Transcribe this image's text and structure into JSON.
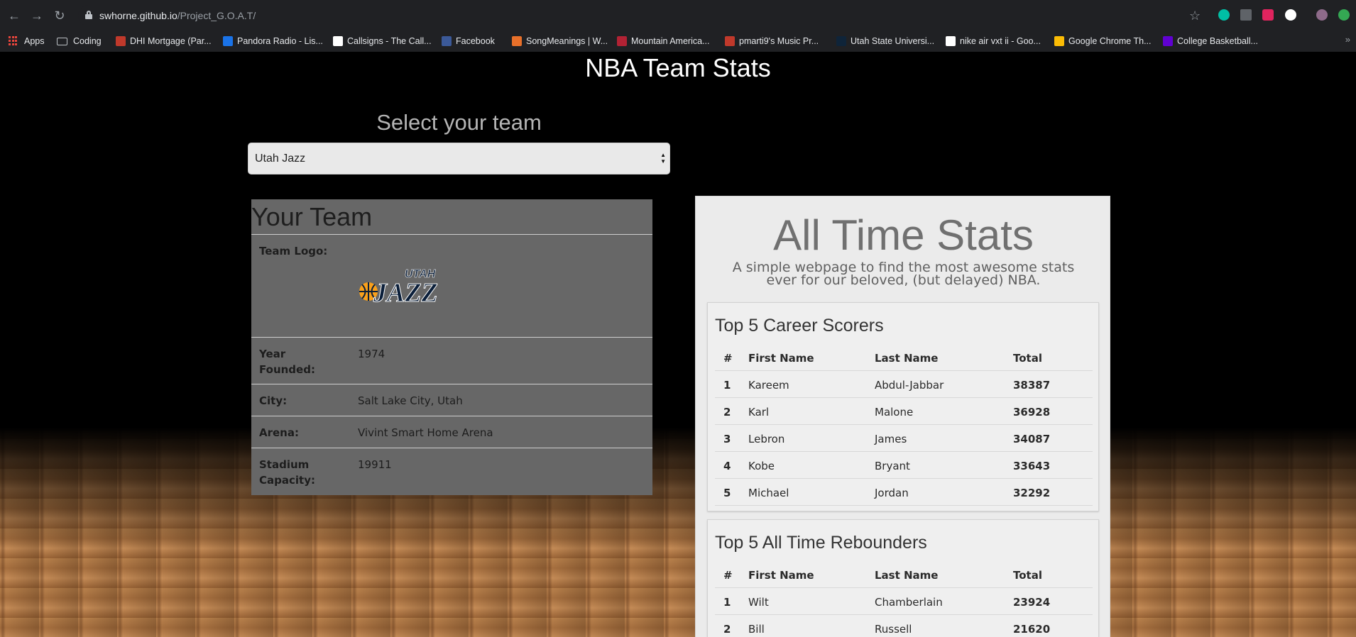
{
  "browser": {
    "url_host": "swhorne.github.io",
    "url_path": "/Project_G.O.A.T/",
    "bookmarks": [
      {
        "label": "Apps",
        "icon": "apps-grid-icon"
      },
      {
        "label": "Coding",
        "icon": "folder-icon"
      },
      {
        "label": "DHI Mortgage (Par...",
        "icon": "dhi-favicon",
        "color": "#c0392b"
      },
      {
        "label": "Pandora Radio - Lis...",
        "icon": "pandora-favicon",
        "color": "#1a73e8"
      },
      {
        "label": "Callsigns - The Call...",
        "icon": "callsigns-favicon",
        "color": "#ffffff"
      },
      {
        "label": "Facebook",
        "icon": "facebook-favicon",
        "color": "#3b5998"
      },
      {
        "label": "SongMeanings | W...",
        "icon": "songmeanings-favicon",
        "color": "#e8702a"
      },
      {
        "label": "Mountain America...",
        "icon": "mountain-america-favicon",
        "color": "#b22234"
      },
      {
        "label": "pmarti9's Music Pr...",
        "icon": "os-favicon",
        "color": "#c0392b"
      },
      {
        "label": "Utah State Universi...",
        "icon": "usu-favicon",
        "color": "#0f2439"
      },
      {
        "label": "nike air vxt ii - Goo...",
        "icon": "google-favicon",
        "color": "#ffffff"
      },
      {
        "label": "Google Chrome Th...",
        "icon": "chrome-favicon",
        "color": "#fbbc05"
      },
      {
        "label": "College Basketball...",
        "icon": "yahoo-favicon",
        "color": "#6001d2"
      }
    ],
    "more": "»"
  },
  "page": {
    "title": "NBA Team Stats",
    "select_label": "Select your team",
    "selected_team": "Utah Jazz"
  },
  "team_card": {
    "heading": "Your Team",
    "logo_label": "Team Logo:",
    "logo_text": "JAZZ",
    "logo_small_text": "UTAH",
    "year_label": "Year Founded:",
    "year": "1974",
    "city_label": "City:",
    "city": "Salt Lake City, Utah",
    "arena_label": "Arena:",
    "arena": "Vivint Smart Home Arena",
    "capacity_label": "Stadium Capacity:",
    "capacity": "19911"
  },
  "stats": {
    "title": "All Time Stats",
    "subtitle": "A simple webpage to find the most awesome stats ever for our beloved, (but delayed) NBA.",
    "scorers": {
      "title": "Top 5 Career Scorers",
      "headers": [
        "#",
        "First Name",
        "Last Name",
        "Total"
      ],
      "rows": [
        [
          "1",
          "Kareem",
          "Abdul-Jabbar",
          "38387"
        ],
        [
          "2",
          "Karl",
          "Malone",
          "36928"
        ],
        [
          "3",
          "Lebron",
          "James",
          "34087"
        ],
        [
          "4",
          "Kobe",
          "Bryant",
          "33643"
        ],
        [
          "5",
          "Michael",
          "Jordan",
          "32292"
        ]
      ]
    },
    "rebounders": {
      "title": "Top 5 All Time Rebounders",
      "headers": [
        "#",
        "First Name",
        "Last Name",
        "Total"
      ],
      "rows": [
        [
          "1",
          "Wilt",
          "Chamberlain",
          "23924"
        ],
        [
          "2",
          "Bill",
          "Russell",
          "21620"
        ]
      ]
    }
  }
}
